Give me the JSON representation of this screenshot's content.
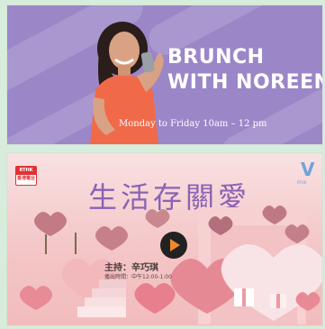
{
  "programs": [
    {
      "title_line1": "BRUNCH",
      "title_line2": "WITH NOREEN",
      "schedule": "Monday to Friday 10am – 12 pm",
      "colors": {
        "background": "#9b86c8",
        "text": "#ffffff"
      }
    },
    {
      "title": "生活存關愛",
      "host": "主持：辛巧琪",
      "schedule": "播出時間：中午12:00-1:00",
      "station_logo_top": "RTHK",
      "station_logo_bottom": "香港電台",
      "channel_logo": "V",
      "channel_logo_sub": "RTHK",
      "play_icon": "play-icon",
      "colors": {
        "background": "#f4c6c7",
        "title": "#8a63b4",
        "play": "#f08a2c"
      }
    }
  ]
}
